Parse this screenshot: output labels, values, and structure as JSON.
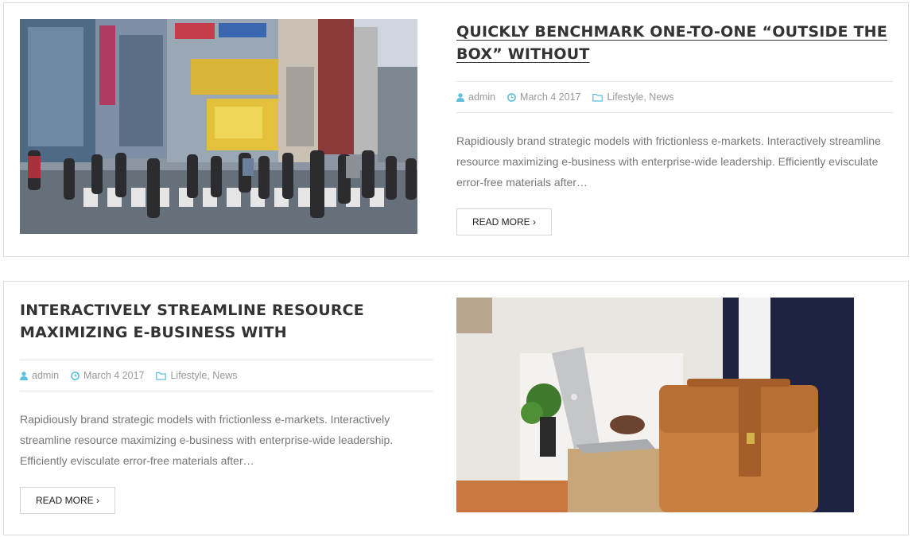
{
  "posts": [
    {
      "title": "QUICKLY BENCHMARK ONE-TO-ONE “OUTSIDE THE BOX” WITHOUT",
      "author": "admin",
      "date": "March 4 2017",
      "categories": [
        "Lifestyle",
        "News"
      ],
      "excerpt": "Rapidiously brand strategic models with frictionless e-markets. Interactively streamline resource maximizing e-business with enterprise-wide leadership. Efficiently evisculate error-free materials after…",
      "read_more": "READ MORE ›",
      "image_icon": "city-crosswalk-photo"
    },
    {
      "title": "INTERACTIVELY STREAMLINE RESOURCE MAXIMIZING E-BUSINESS WITH",
      "author": "admin",
      "date": "March 4 2017",
      "categories": [
        "Lifestyle",
        "News"
      ],
      "excerpt": "Rapidiously brand strategic models with frictionless e-markets. Interactively streamline resource maximizing e-business with enterprise-wide leadership. Efficiently evisculate error-free materials after…",
      "read_more": "READ MORE ›",
      "image_icon": "laptop-briefcase-photo"
    }
  ],
  "colors": {
    "accent": "#5bc0de",
    "title": "#333333",
    "text": "#777777",
    "meta": "#999999",
    "border": "#dcdcdc"
  }
}
